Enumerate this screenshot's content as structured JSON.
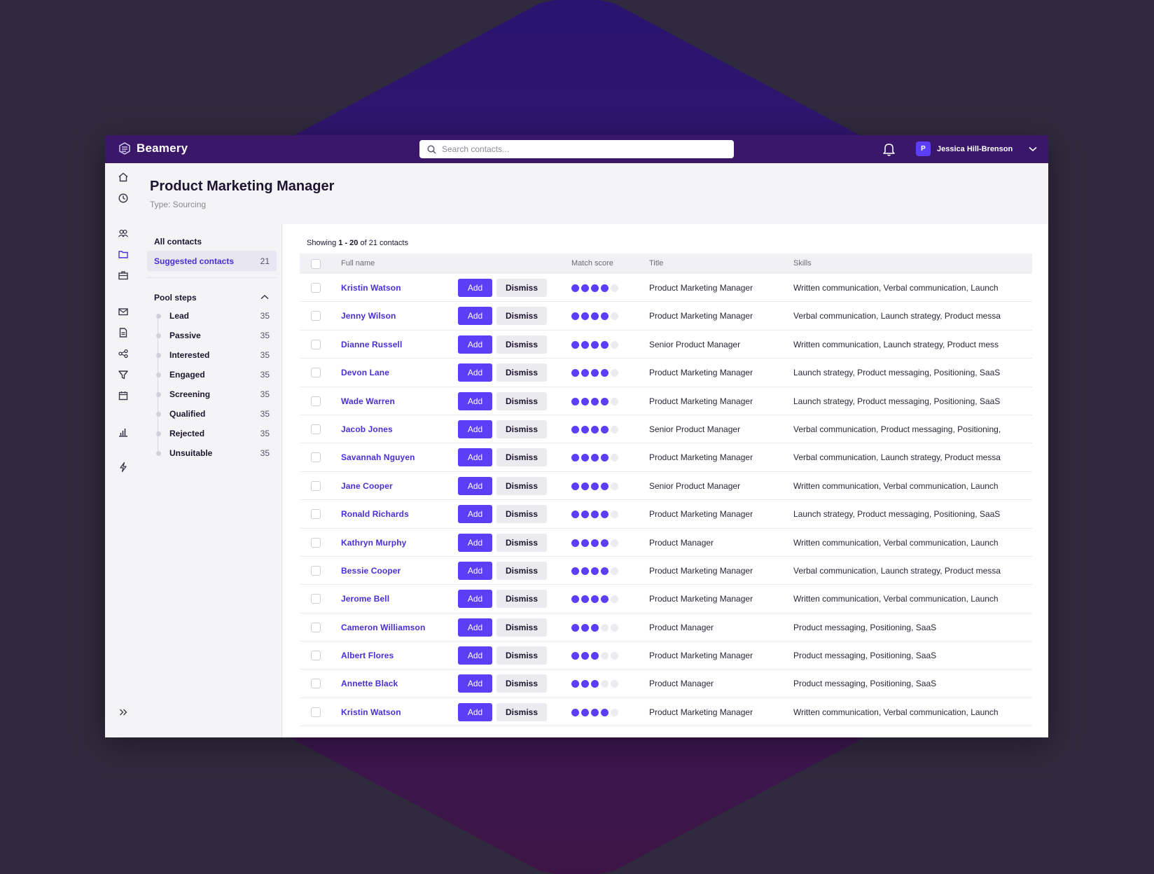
{
  "app": {
    "name": "Beamery"
  },
  "search": {
    "placeholder": "Search contacts..."
  },
  "user": {
    "initial": "P",
    "name": "Jessica Hill-Brenson"
  },
  "page": {
    "title": "Product Marketing Manager",
    "subtitle": "Type: Sourcing"
  },
  "nav_icons": [
    "home-icon",
    "clock-icon",
    "people-icon",
    "folder-icon",
    "briefcase-icon",
    "mail-icon",
    "document-icon",
    "share-icon",
    "filter-icon",
    "calendar-icon",
    "bar-chart-icon",
    "lightning-icon",
    "double-chevron-right-icon"
  ],
  "left_panel": {
    "all_contacts": "All contacts",
    "suggested": {
      "label": "Suggested contacts",
      "count": "21"
    },
    "pool_steps_label": "Pool steps",
    "steps": [
      {
        "label": "Lead",
        "count": "35"
      },
      {
        "label": "Passive",
        "count": "35"
      },
      {
        "label": "Interested",
        "count": "35"
      },
      {
        "label": "Engaged",
        "count": "35"
      },
      {
        "label": "Screening",
        "count": "35"
      },
      {
        "label": "Qualified",
        "count": "35"
      },
      {
        "label": "Rejected",
        "count": "35"
      },
      {
        "label": "Unsuitable",
        "count": "35"
      }
    ]
  },
  "table": {
    "showing_prefix": "Showing",
    "showing_range": "1 - 20",
    "showing_suffix": "of 21 contacts",
    "headers": {
      "name": "Full name",
      "score": "Match score",
      "title": "Title",
      "skills": "Skills"
    },
    "add_label": "Add",
    "dismiss_label": "Dismiss",
    "max_score": 5,
    "rows": [
      {
        "name": "Kristin Watson",
        "score": 4,
        "title": "Product Marketing Manager",
        "skills": "Written communication, Verbal communication, Launch"
      },
      {
        "name": "Jenny Wilson",
        "score": 4,
        "title": "Product Marketing Manager",
        "skills": "Verbal communication, Launch strategy, Product messa"
      },
      {
        "name": "Dianne Russell",
        "score": 4,
        "title": "Senior Product Manager",
        "skills": "Written communication, Launch strategy, Product mess"
      },
      {
        "name": "Devon Lane",
        "score": 4,
        "title": "Product Marketing Manager",
        "skills": "Launch strategy, Product messaging, Positioning, SaaS"
      },
      {
        "name": "Wade Warren",
        "score": 4,
        "title": "Product Marketing Manager",
        "skills": "Launch strategy, Product messaging, Positioning, SaaS"
      },
      {
        "name": "Jacob Jones",
        "score": 4,
        "title": "Senior Product Manager",
        "skills": "Verbal communication, Product messaging, Positioning,"
      },
      {
        "name": "Savannah Nguyen",
        "score": 4,
        "title": "Product Marketing Manager",
        "skills": "Verbal communication, Launch strategy, Product messa"
      },
      {
        "name": "Jane Cooper",
        "score": 4,
        "title": "Senior Product Manager",
        "skills": "Written communication, Verbal communication, Launch"
      },
      {
        "name": "Ronald Richards",
        "score": 4,
        "title": "Product Marketing Manager",
        "skills": "Launch strategy, Product messaging, Positioning, SaaS"
      },
      {
        "name": "Kathryn Murphy",
        "score": 4,
        "title": "Product Manager",
        "skills": "Written communication, Verbal communication, Launch"
      },
      {
        "name": "Bessie Cooper",
        "score": 4,
        "title": "Product Marketing Manager",
        "skills": "Verbal communication, Launch strategy, Product messa"
      },
      {
        "name": "Jerome Bell",
        "score": 4,
        "title": "Product Marketing Manager",
        "skills": "Written communication, Verbal communication, Launch"
      },
      {
        "name": "Cameron Williamson",
        "score": 3,
        "title": "Product Manager",
        "skills": "Product messaging, Positioning, SaaS"
      },
      {
        "name": "Albert Flores",
        "score": 3,
        "title": "Product Marketing Manager",
        "skills": "Product messaging, Positioning, SaaS"
      },
      {
        "name": "Annette Black",
        "score": 3,
        "title": "Product Manager",
        "skills": "Product messaging, Positioning, SaaS"
      },
      {
        "name": "Kristin Watson",
        "score": 4,
        "title": "Product Marketing Manager",
        "skills": "Written communication, Verbal communication, Launch"
      }
    ]
  },
  "colors": {
    "topbar": "#3b1769",
    "accent": "#5b3ef5",
    "link": "#4b2fd6",
    "background": "#2f2a3d"
  }
}
